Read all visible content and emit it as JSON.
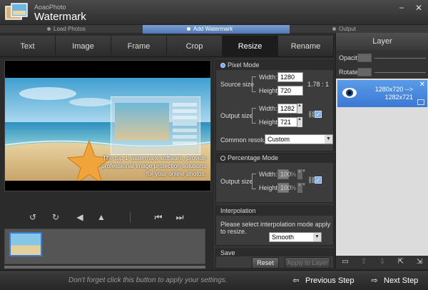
{
  "app": {
    "subtitle": "AoaoPhoto",
    "title": "Watermark"
  },
  "window_controls": {
    "minimize": "−",
    "close": "✕"
  },
  "steps": [
    "Load Photos",
    "Add Watermark",
    "Output"
  ],
  "tabs": [
    "Text",
    "Image",
    "Frame",
    "Crop",
    "Resize",
    "Rename"
  ],
  "active_tab": "Resize",
  "preview": {
    "overlay_text": "The top 1 watermark software, provide professional image protection solutions for your online photos."
  },
  "pixel_mode": {
    "title": "Pixel Mode",
    "source_label": "Source size",
    "width_label": "Width:",
    "height_label": "Height:",
    "source_width": "1280",
    "source_height": "720",
    "ratio": "1.78 : 1",
    "output_label": "Output size",
    "output_width": "1282",
    "output_height": "721",
    "common_label": "Common resolution:",
    "common_value": "Custom"
  },
  "percentage_mode": {
    "title": "Percentage Mode",
    "output_label": "Output size",
    "width_label": "Width:",
    "height_label": "Height:",
    "width": "100",
    "height": "100",
    "unit": "%"
  },
  "interpolation": {
    "title": "Interpolation",
    "hint": "Please select interpolation mode apply to resize.",
    "value": "Smooth"
  },
  "save_section": {
    "title": "Save",
    "reset_label": "Reset",
    "apply_label": "Apply to Layer"
  },
  "layer_panel": {
    "title": "Layer",
    "opacity_label": "Opacity",
    "rotate_label": "Rotate",
    "item_line1": "1280x720 -->",
    "item_line2": "1282x721"
  },
  "bottom": {
    "hint": "Don't forget click this button to apply your settings.",
    "prev_label": "Previous Step",
    "next_label": "Next Step"
  },
  "colors": {
    "accent": "#4f7fd0",
    "layer_selected": "#3b79d4"
  }
}
